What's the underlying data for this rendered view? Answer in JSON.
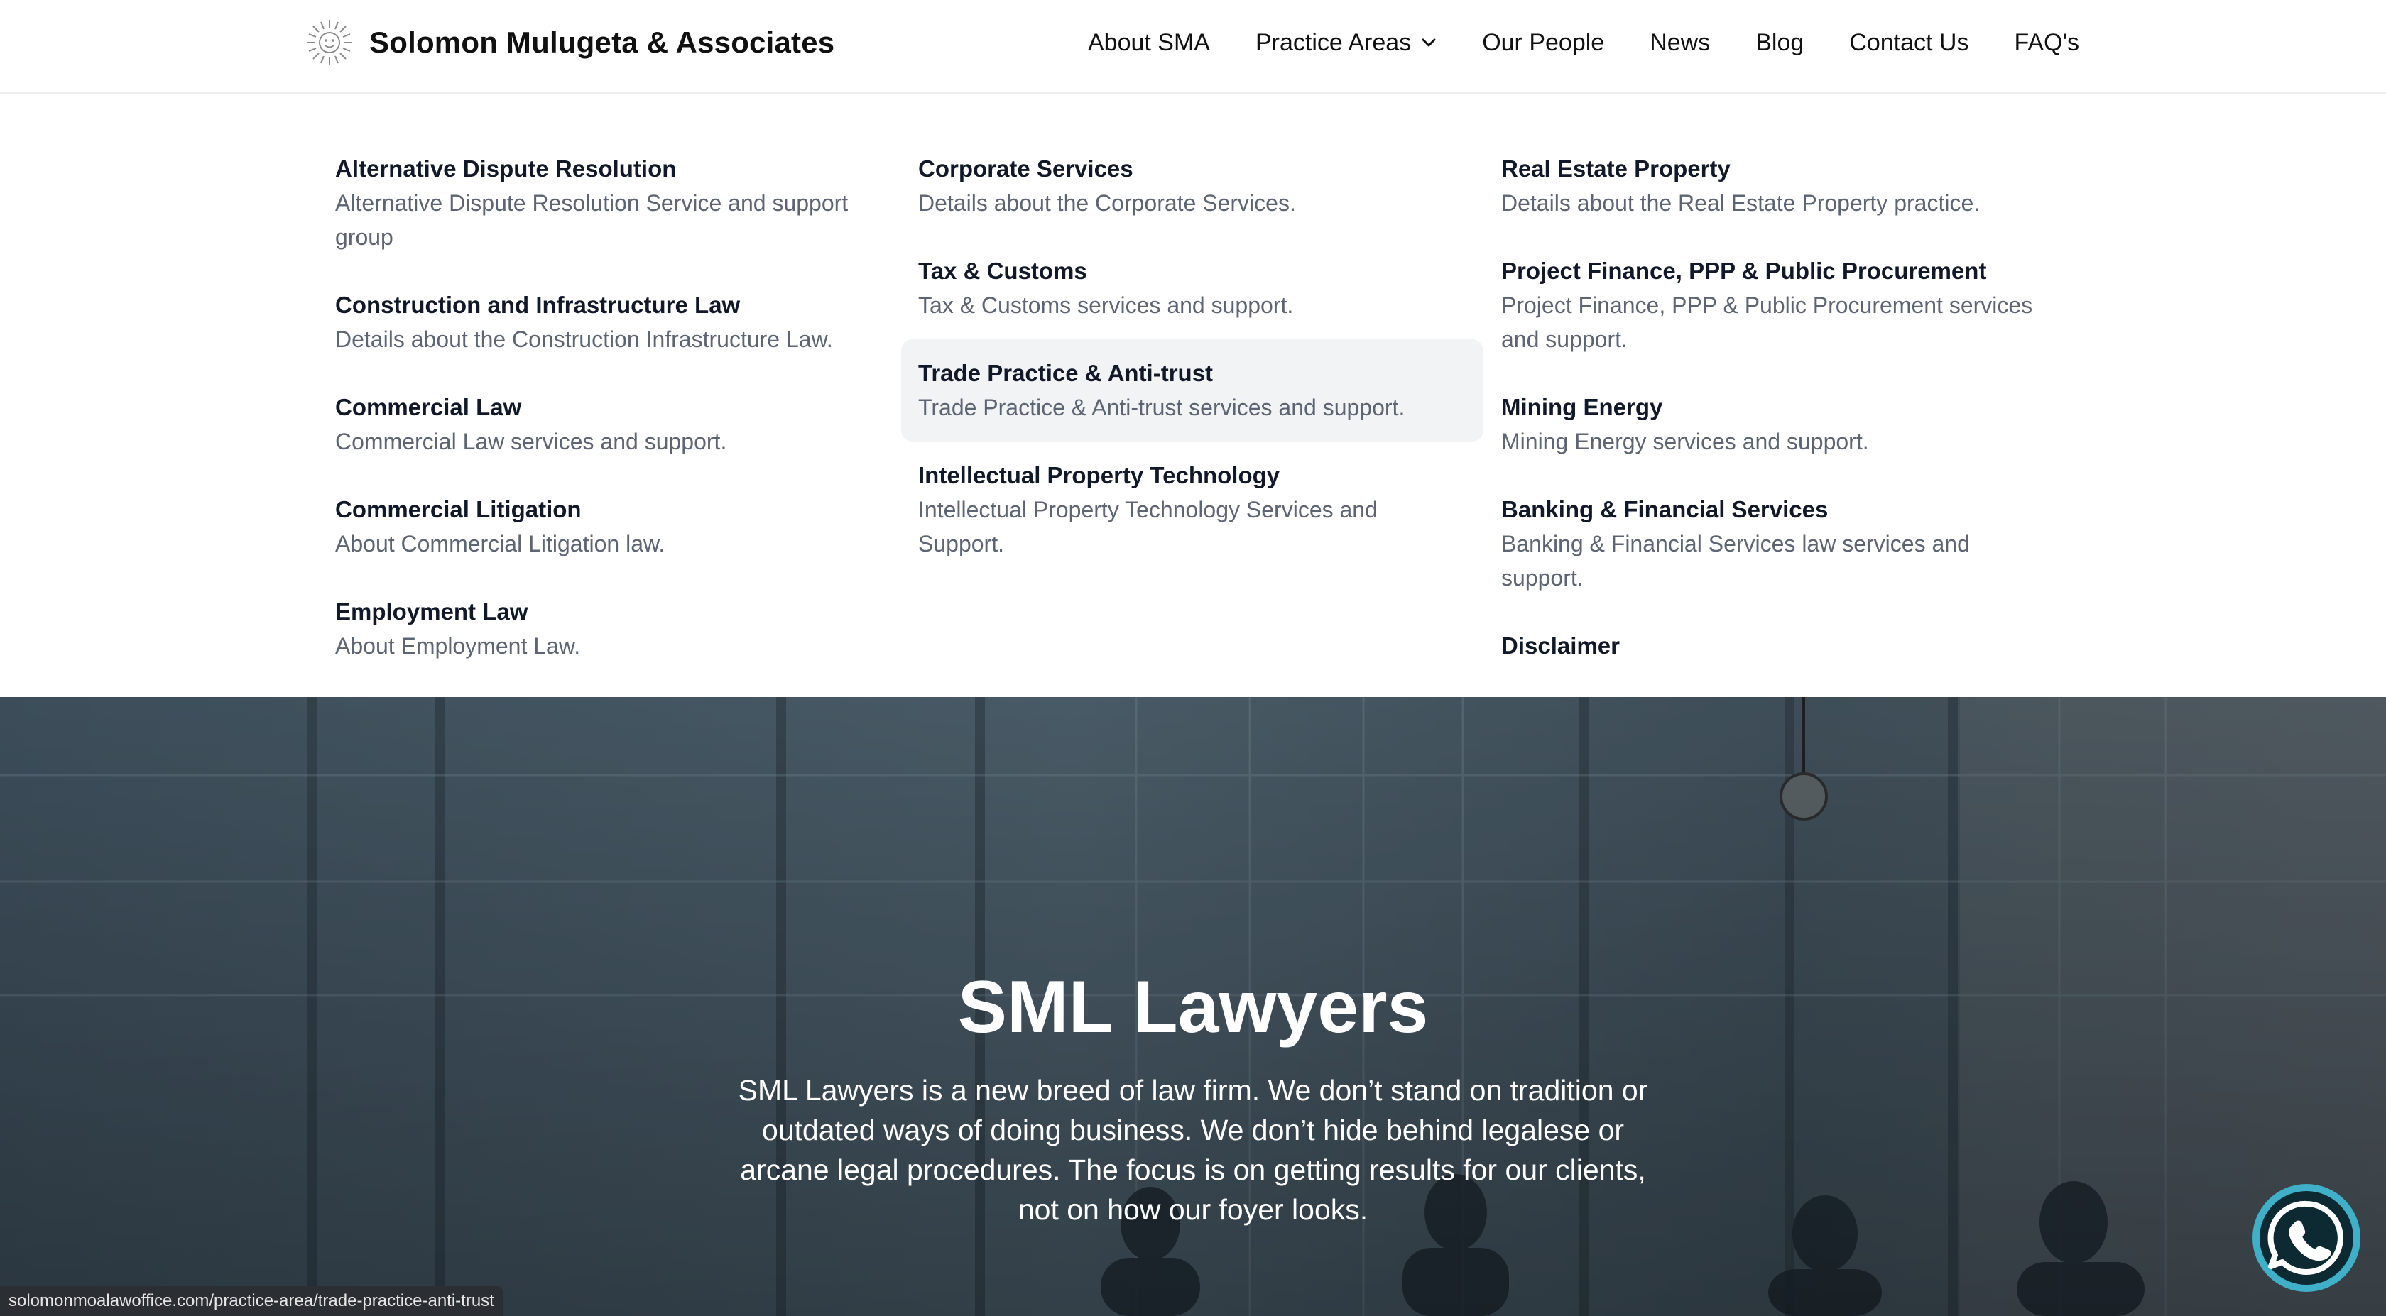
{
  "header": {
    "brand_name": "Solomon Mulugeta & Associates",
    "nav": [
      {
        "label": "About SMA"
      },
      {
        "label": "Practice Areas"
      },
      {
        "label": "Our People"
      },
      {
        "label": "News"
      },
      {
        "label": "Blog"
      },
      {
        "label": "Contact Us"
      },
      {
        "label": "FAQ's"
      }
    ]
  },
  "mega_menu": {
    "columns": [
      {
        "items": [
          {
            "title": "Alternative Dispute Resolution",
            "desc": "Alternative Dispute Resolution Service and support group"
          },
          {
            "title": "Construction and Infrastructure Law",
            "desc": "Details about the Construction Infrastructure Law."
          },
          {
            "title": "Commercial Law",
            "desc": "Commercial Law services and support."
          },
          {
            "title": "Commercial Litigation",
            "desc": "About Commercial Litigation law."
          },
          {
            "title": "Employment Law",
            "desc": "About Employment Law."
          }
        ]
      },
      {
        "items": [
          {
            "title": "Corporate Services",
            "desc": "Details about the Corporate Services."
          },
          {
            "title": "Tax & Customs",
            "desc": "Tax & Customs services and support."
          },
          {
            "title": "Trade Practice & Anti-trust",
            "desc": "Trade Practice & Anti-trust services and support."
          },
          {
            "title": "Intellectual Property Technology",
            "desc": "Intellectual Property Technology Services and Support."
          }
        ]
      },
      {
        "items": [
          {
            "title": "Real Estate Property",
            "desc": "Details about the Real Estate Property practice."
          },
          {
            "title": "Project Finance, PPP & Public Procurement",
            "desc": "Project Finance, PPP & Public Procurement services and support."
          },
          {
            "title": "Mining Energy",
            "desc": "Mining Energy services and support."
          },
          {
            "title": "Banking & Financial Services",
            "desc": "Banking & Financial Services law services and support."
          },
          {
            "title": "Disclaimer",
            "desc": ""
          }
        ]
      }
    ],
    "highlighted_item": "Trade Practice & Anti-trust"
  },
  "hero": {
    "title": "SML Lawyers",
    "text": "SML Lawyers is a new breed of law firm. We don’t stand on tradition or outdated ways of doing business. We don’t hide behind legalese or arcane legal procedures. The focus is on getting results for our clients, not on how our foyer looks."
  },
  "status_bar": {
    "url": "solomonmoalawoffice.com/practice-area/trade-practice-anti-trust"
  },
  "icons": {
    "logo": "sun-logo-icon",
    "practice_areas_chevron": "chevron-down-icon",
    "whatsapp": "whatsapp-icon"
  },
  "colors": {
    "text": "#111827",
    "muted": "#5d6472",
    "highlight_bg": "#f2f3f5",
    "whatsapp_ring": "#3fb0c7"
  }
}
